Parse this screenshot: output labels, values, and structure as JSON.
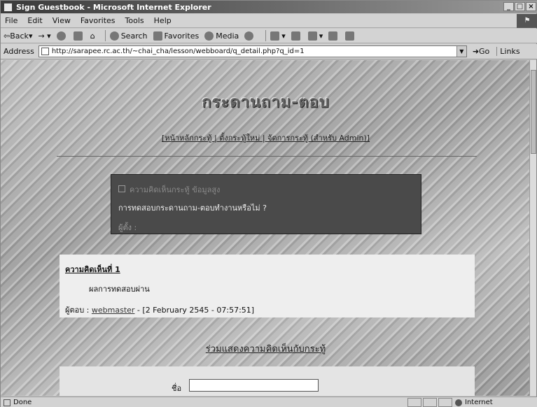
{
  "window": {
    "title": "Sign Guestbook - Microsoft Internet Explorer",
    "buttons": [
      "_",
      "□",
      "×"
    ]
  },
  "menu": [
    "File",
    "Edit",
    "View",
    "Favorites",
    "Tools",
    "Help"
  ],
  "toolbar": {
    "back": "Back",
    "search": "Search",
    "favorites": "Favorites",
    "media": "Media"
  },
  "address": {
    "label": "Address",
    "url": "http://sarapee.rc.ac.th/~chai_cha/lesson/webboard/q_detail.php?q_id=1",
    "go": "Go",
    "links": "Links"
  },
  "page": {
    "heading": "กระดานถาม-ตอบ",
    "nav": "[หน้าหลักกระทู้ | ตั้งกระทู้ใหม่ | จัดการกระทู้ (สำหรับ Admin)]",
    "question_meta": "ความคิดเห็นกระทู้ ข้อมูลสูง",
    "question": "การทดสอบกระดานถาม-ตอบทำงานหรือไม่ ?",
    "question_author": "ผู้ตั้ง :",
    "answer_heading": "ความคิดเห็นที่ 1",
    "answer_body": "ผลการทดสอบผ่าน",
    "answer_prefix": "ผู้ตอบ :",
    "answer_user": "webmaster",
    "answer_date": " - [2 February 2545 - 07:57:51]",
    "reply_link": "ร่วมแสดงความคิดเห็นกับกระทู้",
    "form_name_label": "ชื่อ"
  },
  "status": {
    "text": "Done",
    "zone": "Internet"
  }
}
